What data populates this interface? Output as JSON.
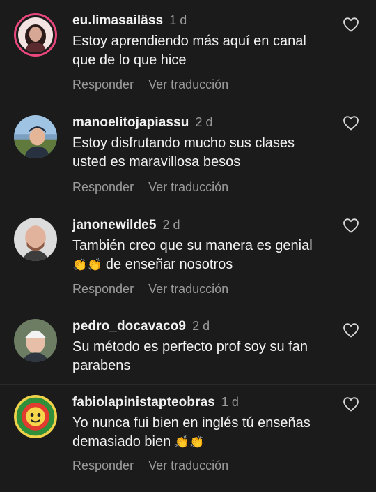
{
  "comments": [
    {
      "username": "eu.limasailäss",
      "time": "1 d",
      "text_line1": "Estoy aprendiendo más aquí en canal",
      "text_line2": "que de lo que hice",
      "reply_label": "Responder",
      "translate_label": "Ver traducción"
    },
    {
      "username": "manoelitojapiassu",
      "time": "2 d",
      "text_line1": "Estoy disfrutando mucho sus clases",
      "text_line2": "usted es maravillosa besos",
      "reply_label": "Responder",
      "translate_label": "Ver traducción"
    },
    {
      "username": "janonewilde5",
      "time": "2 d",
      "text_line1": "También creo que su manera es genial",
      "text_line2_emoji": "👏👏",
      "text_line2": "de enseñar nosotros",
      "reply_label": "Responder",
      "translate_label": "Ver traducción"
    },
    {
      "username": "pedro_docavaco9",
      "time": "2 d",
      "text_line1": "Su método es perfecto prof soy su fan",
      "text_line2": "parabens"
    },
    {
      "username": "fabiolapinistapteobras",
      "time": "1 d",
      "text_line1": "Yo nunca fui bien en inglés tú enseñas",
      "text_line2": "demasiado bien",
      "text_line2_emoji": "👏👏",
      "reply_label": "Responder",
      "translate_label": "Ver traducción"
    }
  ],
  "colors": {
    "background": "#1b1b1b",
    "text": "#f2f2f2",
    "muted": "#9a9a9a",
    "story_ring": "#e8477c"
  },
  "icons": {
    "like": "heart-outline-icon"
  }
}
